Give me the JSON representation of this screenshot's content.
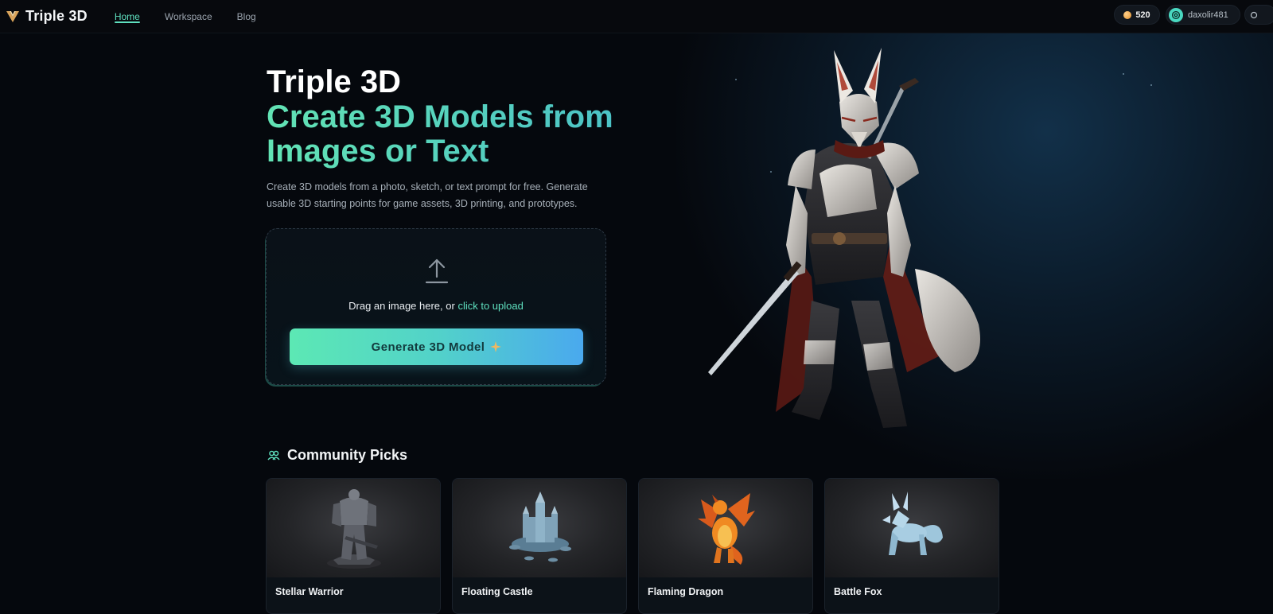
{
  "app": {
    "name": "Triple 3D"
  },
  "nav": {
    "items": [
      {
        "label": "Home",
        "active": true
      },
      {
        "label": "Workspace",
        "active": false
      },
      {
        "label": "Blog",
        "active": false
      }
    ]
  },
  "account": {
    "credits": "520",
    "username": "daxolir481"
  },
  "hero": {
    "title": "Triple 3D",
    "subtitle_line1": "Create 3D Models from",
    "subtitle_line2": "Images or Text",
    "description": "Create 3D models from a photo, sketch, or text prompt for free. Generate usable 3D starting points for game assets, 3D printing, and prototypes."
  },
  "upload": {
    "prompt": "Drag an image here, or",
    "link": "click to upload",
    "generate_label": "Generate 3D Model"
  },
  "community": {
    "title": "Community Picks",
    "items": [
      {
        "title": "Stellar Warrior",
        "icon": "warrior-model"
      },
      {
        "title": "Floating Castle",
        "icon": "castle-model"
      },
      {
        "title": "Flaming Dragon",
        "icon": "dragon-model"
      },
      {
        "title": "Battle Fox",
        "icon": "fox-model"
      }
    ]
  },
  "colors": {
    "accent": "#5fe0bf",
    "background": "#05080d",
    "button_gradient_start": "#5ce8b4",
    "button_gradient_end": "#4aa9ee"
  }
}
